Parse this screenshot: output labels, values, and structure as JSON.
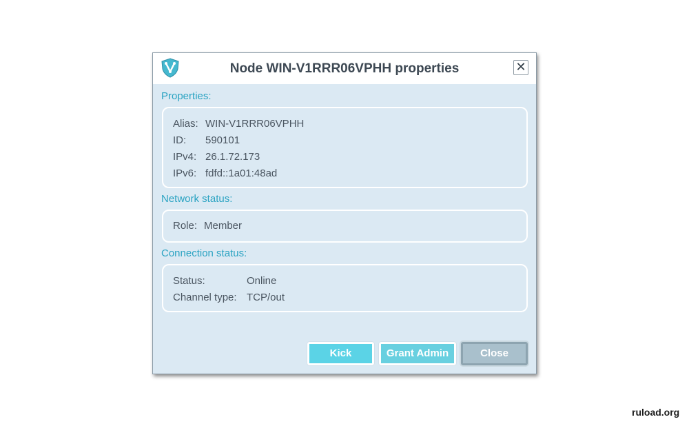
{
  "dialog": {
    "title": "Node WIN-V1RRR06VPHH properties",
    "close_glyph": "✕",
    "app_icon": "shield-v-icon",
    "accent_color": "#2aa3c2"
  },
  "properties": {
    "label": "Properties:",
    "rows": [
      {
        "key": "Alias:",
        "value": "WIN-V1RRR06VPHH"
      },
      {
        "key": "ID:",
        "value": "590101"
      },
      {
        "key": "IPv4:",
        "value": "26.1.72.173"
      },
      {
        "key": "IPv6:",
        "value": "fdfd::1a01:48ad"
      }
    ]
  },
  "network_status": {
    "label": "Network status:",
    "rows": [
      {
        "key": "Role:",
        "value": "Member"
      }
    ]
  },
  "connection_status": {
    "label": "Connection status:",
    "rows": [
      {
        "key": "Status:",
        "value": "Online"
      },
      {
        "key": "Channel type:",
        "value": "TCP/out"
      }
    ]
  },
  "buttons": {
    "kick": "Kick",
    "grant_admin": "Grant Admin",
    "close": "Close"
  },
  "watermark": "ruload.org"
}
